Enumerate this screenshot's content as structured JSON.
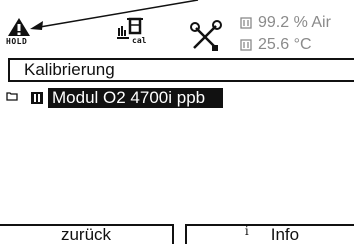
{
  "status": {
    "hold_label": "HOLD",
    "cal_label": "cal",
    "measurement_1": "99.2 % Air",
    "measurement_2": "25.6 °C"
  },
  "menu": {
    "title": "Kalibrierung",
    "selected_item": "Modul O2 4700i ppb"
  },
  "softkeys": {
    "left_label": "zurück",
    "right_icon": "i",
    "right_label": "Info"
  },
  "icons": {
    "hold": "warning-hold-icon",
    "calibration": "calibration-icon",
    "maintenance": "tools-icon",
    "folder": "folder-icon",
    "module": "module-icon",
    "measurement": "sensor-icon"
  },
  "colors": {
    "foreground": "#111111",
    "muted": "#8a8a8a",
    "background": "#ffffff",
    "highlight_text": "#ffffff"
  }
}
